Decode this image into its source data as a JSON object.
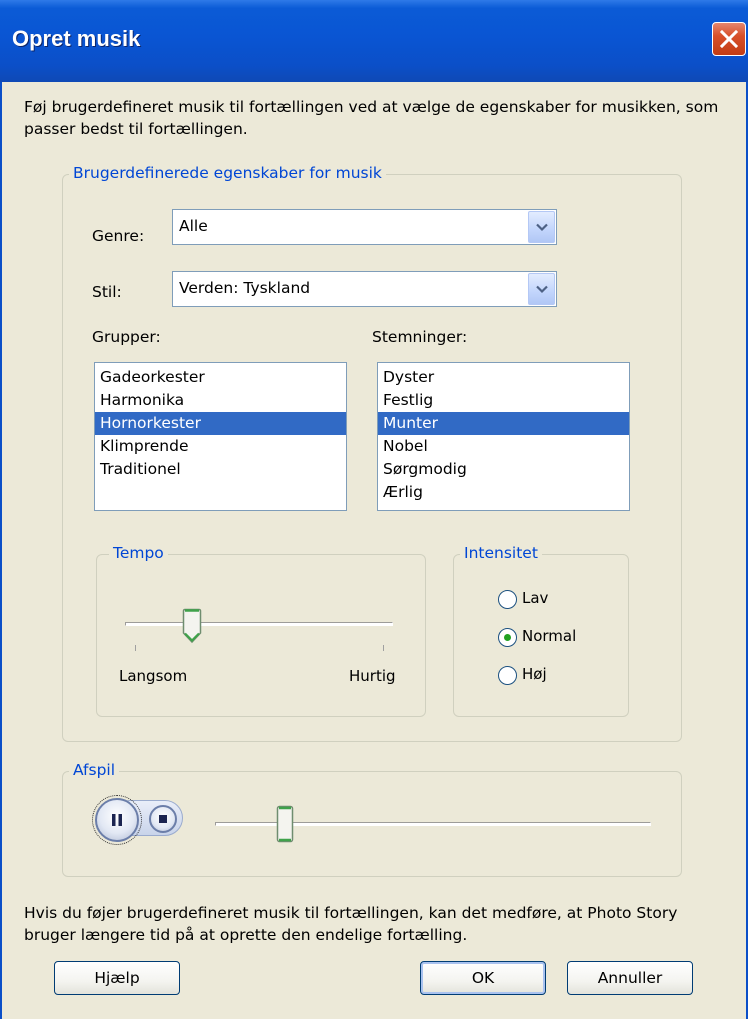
{
  "window": {
    "title": "Opret musik"
  },
  "intro_text": "Føj brugerdefineret musik til fortællingen ved at vælge de egenskaber for musikken, som passer bedst til fortællingen.",
  "properties_group": {
    "legend": "Brugerdefinerede egenskaber for musik",
    "genre_label": "Genre:",
    "genre_value": "Alle",
    "style_label": "Stil:",
    "style_value": "Verden: Tyskland",
    "groups_label": "Grupper:",
    "groups": [
      "Gadeorkester",
      "Harmonika",
      "Hornorkester",
      "Klimprende",
      "Traditionel"
    ],
    "groups_selected": "Hornorkester",
    "moods_label": "Stemninger:",
    "moods": [
      "Dyster",
      "Festlig",
      "Munter",
      "Nobel",
      "Sørgmodig",
      "Ærlig"
    ],
    "moods_selected": "Munter",
    "tempo": {
      "legend": "Tempo",
      "min_label": "Langsom",
      "max_label": "Hurtig",
      "level": 0.25
    },
    "intensity": {
      "legend": "Intensitet",
      "options": [
        "Lav",
        "Normal",
        "Høj"
      ],
      "selected": "Normal"
    }
  },
  "playback": {
    "legend": "Afspil",
    "position": 0.16
  },
  "footer_text": "Hvis du føjer brugerdefineret musik til fortællingen, kan det medføre, at Photo Story bruger længere tid på at oprette den endelige fortælling.",
  "buttons": {
    "help": "Hjælp",
    "ok": "OK",
    "cancel": "Annuller"
  },
  "colors": {
    "title_bar": "#0a55d3",
    "selection": "#316ac5",
    "group_legend": "#0046d5",
    "dialog_bg": "#ece9d8"
  }
}
